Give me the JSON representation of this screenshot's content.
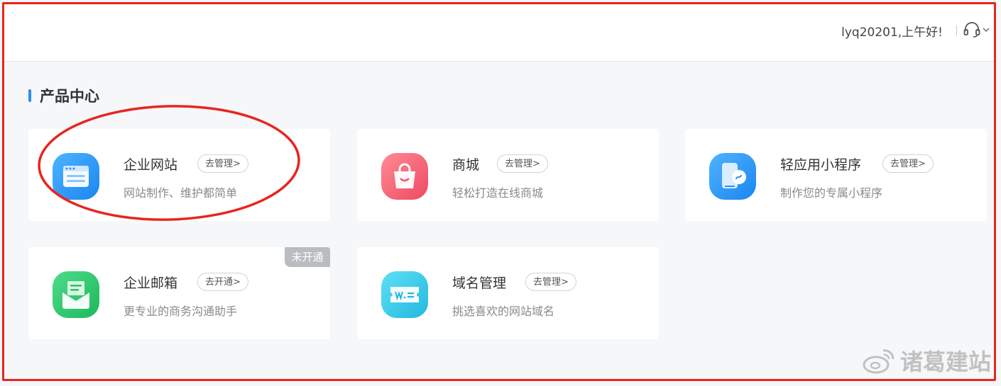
{
  "header": {
    "greeting": "lyq20201,上午好!",
    "support_icon": "headset-icon",
    "dropdown_icon": "chevron-down-icon"
  },
  "section": {
    "title": "产品中心"
  },
  "products": [
    {
      "name": "企业网站",
      "action": "去管理>",
      "desc": "网站制作、维护都简单",
      "icon": "website-icon",
      "color": "#2d8cf0"
    },
    {
      "name": "商城",
      "action": "去管理>",
      "desc": "轻松打造在线商城",
      "icon": "shopping-bag-icon",
      "color": "#f0556b"
    },
    {
      "name": "轻应用小程序",
      "action": "去管理>",
      "desc": "制作您的专属小程序",
      "icon": "mini-program-icon",
      "color": "#2d8cf0"
    },
    {
      "name": "企业邮箱",
      "action": "去开通>",
      "desc": "更专业的商务沟通助手",
      "icon": "mail-icon",
      "color": "#27c46a",
      "badge": "未开通"
    },
    {
      "name": "域名管理",
      "action": "去管理>",
      "desc": "挑选喜欢的网站域名",
      "icon": "domain-icon",
      "color": "#2bc3e6"
    }
  ],
  "colors": {
    "annotation": "#e8251f",
    "accent": "#2e8cf0"
  },
  "watermark": {
    "text": "诸葛建站"
  }
}
